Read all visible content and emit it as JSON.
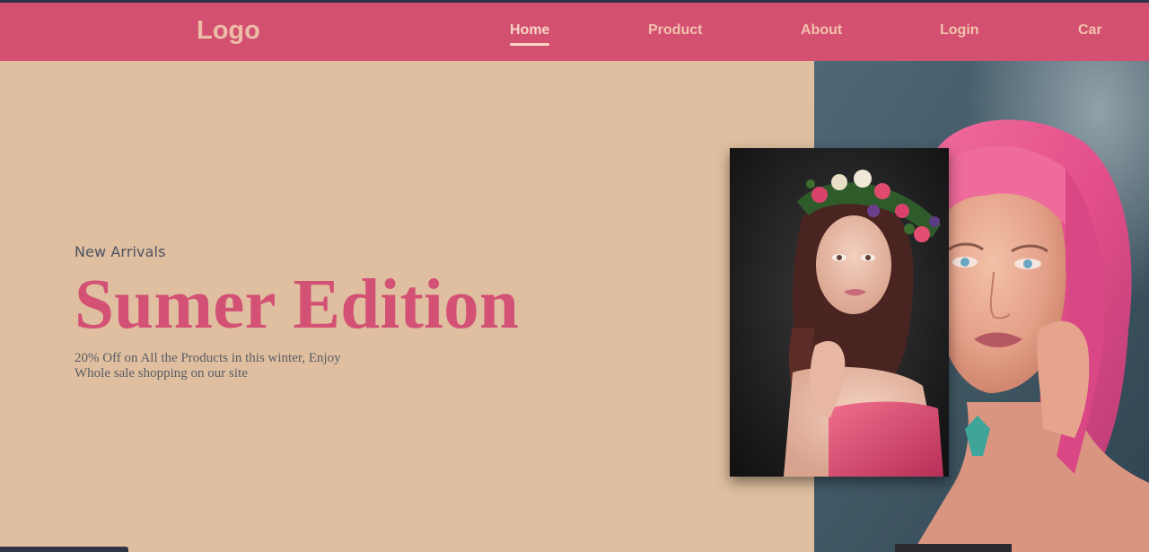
{
  "navbar": {
    "logo": "Logo",
    "links": [
      {
        "label": "Home",
        "active": true
      },
      {
        "label": "Product"
      },
      {
        "label": "About"
      },
      {
        "label": "Login"
      },
      {
        "label": "Car"
      }
    ]
  },
  "hero": {
    "eyebrow": "New Arrivals",
    "headline": "Sumer Edition",
    "subtext": "20% Off on All the Products in this winter, Enjoy Whole sale shopping on our site"
  },
  "colors": {
    "background": "#dfbf9f",
    "navbar": "#d35071",
    "accent": "#d45176",
    "nav_text": "#f2c3ad"
  },
  "images": {
    "main_photo": "woman-pink-hair-portrait",
    "inset_photo": "woman-flower-crown-portrait"
  }
}
